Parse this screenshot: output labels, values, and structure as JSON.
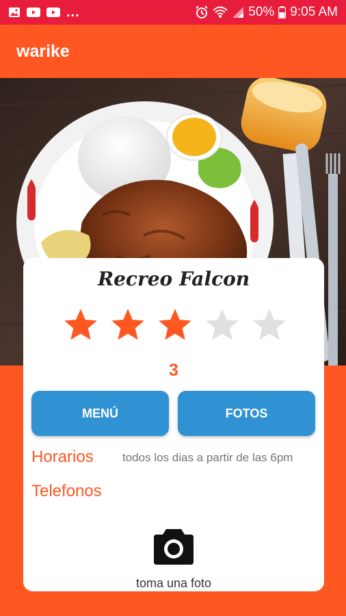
{
  "status_bar": {
    "battery": "50%",
    "time": "9:05 AM",
    "left_icons": [
      "image-icon",
      "youtube-icon",
      "youtube-icon"
    ],
    "overflow": "..."
  },
  "app_bar": {
    "title": "warike"
  },
  "restaurant": {
    "name": "Recreo Falcon",
    "rating": 3,
    "rating_max": 5,
    "rating_display": "3"
  },
  "buttons": {
    "menu": "MENÚ",
    "fotos": "FOTOS"
  },
  "info": {
    "horarios_label": "Horarios",
    "horarios_value": "todos los dias  a partir de las 6pm",
    "telefonos_label": "Telefonos"
  },
  "camera": {
    "label": "toma una foto"
  },
  "colors": {
    "status_bar": "#E81C3B",
    "primary": "#FF5722",
    "button": "#3192D3",
    "star_empty": "#E0E0E0"
  }
}
